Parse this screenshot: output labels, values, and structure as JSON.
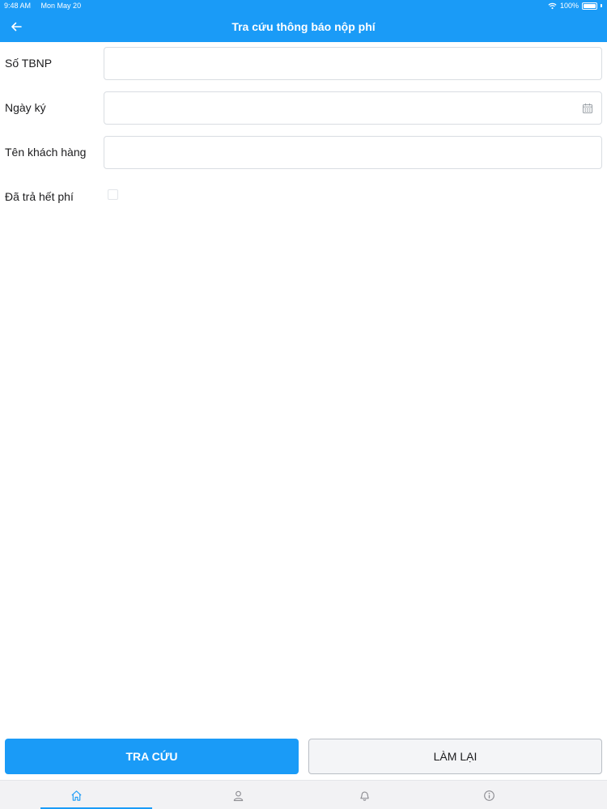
{
  "status": {
    "time": "9:48 AM",
    "date": "Mon May 20",
    "battery": "100%"
  },
  "header": {
    "title": "Tra cứu thông báo nộp phí"
  },
  "form": {
    "notice_number": {
      "label": "Số TBNP",
      "value": ""
    },
    "sign_date": {
      "label": "Ngày ký",
      "value": ""
    },
    "customer_name": {
      "label": "Tên khách hàng",
      "value": ""
    },
    "fully_paid": {
      "label": "Đã trả hết phí",
      "checked": false
    }
  },
  "actions": {
    "search_label": "TRA CỨU",
    "reset_label": "LÀM LẠI"
  },
  "tabbar": {
    "active": "home",
    "items": [
      "home-icon",
      "user-icon",
      "bell-icon",
      "info-icon"
    ]
  },
  "colors": {
    "accent": "#1a9bf7",
    "border": "#d9dde2",
    "tabbar_bg": "#f2f2f4"
  }
}
